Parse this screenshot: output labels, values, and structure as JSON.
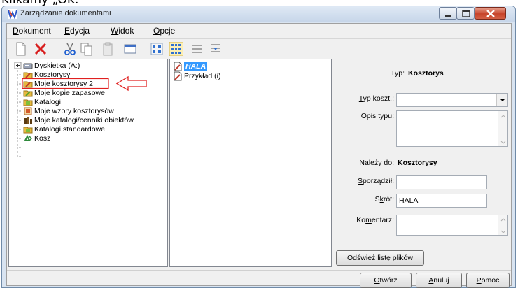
{
  "top_caption": "Klikamy „OK.",
  "window": {
    "title": "Zarządzanie dokumentami"
  },
  "menu": [
    {
      "label": "Dokument",
      "u": "D",
      "rest": "okument"
    },
    {
      "label": "Edycja",
      "u": "E",
      "rest": "dycja"
    },
    {
      "label": "Widok",
      "u": "W",
      "rest": "idok"
    },
    {
      "label": "Opcje",
      "u": "O",
      "rest": "pcje"
    }
  ],
  "toolbar_icons": [
    "new-document-icon",
    "delete-icon",
    "cut-icon",
    "copy-icon",
    "paste-icon",
    "preview-icon",
    "large-icons-icon",
    "small-icons-icon",
    "list-view-icon",
    "details-view-icon"
  ],
  "tree": [
    {
      "label": "Dyskietka (A:)",
      "icon": "floppy-drive-icon",
      "color": "#7f8aa0"
    },
    {
      "label": "Kosztorysy",
      "icon": "folder-estimates-icon",
      "color": "#d6a730"
    },
    {
      "label": "Moje kosztorysy 2",
      "icon": "folder-estimates-icon",
      "color": "#d6a730"
    },
    {
      "label": "Moje kopie zapasowe",
      "icon": "folder-backup-icon",
      "color": "#8dbb3c"
    },
    {
      "label": "Katalogi",
      "icon": "folder-catalog-icon",
      "color": "#8dbb3c"
    },
    {
      "label": "Moje wzory kosztorysów",
      "icon": "templates-icon",
      "color": "#c0522a"
    },
    {
      "label": "Moje katalogi/cenniki obiektów",
      "icon": "price-list-icon",
      "color": "#6b4b1f"
    },
    {
      "label": "Katalogi standardowe",
      "icon": "folder-catalog-icon",
      "color": "#8dbb3c"
    },
    {
      "label": "Kosz",
      "icon": "recycle-bin-icon",
      "color": "#2f8a3c"
    }
  ],
  "files": [
    {
      "label": "HALA",
      "selected": true
    },
    {
      "label": "Przykład (i)",
      "selected": false
    }
  ],
  "props": {
    "typ_label": "Typ:",
    "typ_value": "Kosztorys",
    "typ_koszt_label": "Typ koszt.:",
    "typ_koszt_value": "",
    "opis_typu_label": "Opis typu:",
    "nalezy_do_label": "Należy do:",
    "nalezy_do_value": "Kosztorysy",
    "sporzadzil_label": "Sporządził:",
    "sporzadzil_value": "",
    "skrot_label": "Skrót:",
    "skrot_value": "HALA",
    "komentarz_label": "Komentarz:",
    "refresh_label": "Odśwież listę plików"
  },
  "buttons": {
    "open": "Otwórz",
    "cancel": "Anuluj",
    "help": "Pomoc"
  },
  "colors": {
    "highlight_box": "#e02020",
    "selection": "#3399ff",
    "accent": "#e02020"
  }
}
